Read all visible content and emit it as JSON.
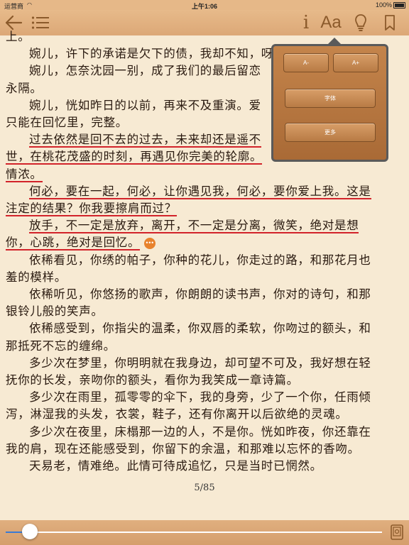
{
  "status_bar": {
    "carrier": "运营商",
    "time": "上午1:06",
    "battery": "100%"
  },
  "toolbar": {
    "info_label": "i",
    "font_label": "Aa"
  },
  "font_popover": {
    "decrease": "A-",
    "increase": "A+",
    "font": "字体",
    "more": "更多"
  },
  "page": {
    "number": "5/85",
    "progress": 0.065
  },
  "content": {
    "p0": "上。",
    "p1": "婉儿，许下的承诺是欠下的债，我却不知，呀",
    "p2": "婉儿，怎奈沈园一别，成了我们的最后留恋",
    "p2b": "永隔。",
    "p3": "婉儿，恍如昨日的以前，再来不及重演。爱",
    "p3b": "只能在回忆里，完整。",
    "p4": "过去依然是回不去的过去，未来却还是遥不",
    "p4b": "世，在桃花茂盛的时刻，再遇见你完美的轮廓。",
    "p4c": "情浓。",
    "p5": "何必，要在一起，何必，让你遇见我，何必，要你爱上我。这是",
    "p5b": "注定的结果？你我要擦肩而过？",
    "p6": "放手，不一定是放弃，离开，不一定是分离，微笑，绝对是想",
    "p6b": "你，心跳，绝对是回忆。",
    "p7": "依稀看见，你绣的帕子，你种的花儿，你走过的路，和那花月也",
    "p7b": "羞的模样。",
    "p8": "依稀听见，你悠扬的歌声，你朗朗的读书声，你对的诗句，和那",
    "p8b": "银铃儿般的笑声。",
    "p9": "依稀感受到，你指尖的温柔，你双唇的柔软，你吻过的额头，和",
    "p9b": "那抵死不忘的缠绵。",
    "p10": "多少次在梦里，你明明就在我身边，却可望不可及，我好想在轻",
    "p10b": "抚你的长发，亲吻你的额头，看你为我笑成一章诗篇。",
    "p11": "多少次在雨里，孤零零的伞下，我的身旁，少了一个你，任雨倾",
    "p11b": "泻，淋湿我的头发，衣裳，鞋子，还有你离开以后欲绝的灵魂。",
    "p12": "多少次在夜里，床榻那一边的人，不是你。恍如昨夜，你还靠在",
    "p12b": "我的肩，现在还能感受到，你留下的余温，和那难以忘怀的香吻。",
    "p13": "天易老，情难绝。此情可待成追忆，只是当时已惘然。"
  },
  "colors": {
    "toolbar": "#e0ae7e",
    "paper": "#f7ead3",
    "highlight": "#d2232a",
    "note": "#e8822c"
  },
  "icons": [
    "back-arrow-icon",
    "toc-list-icon",
    "info-icon",
    "font-size-icon",
    "lightbulb-icon",
    "bookmark-icon",
    "note-icon",
    "book-icon",
    "wifi-icon",
    "battery-icon"
  ]
}
